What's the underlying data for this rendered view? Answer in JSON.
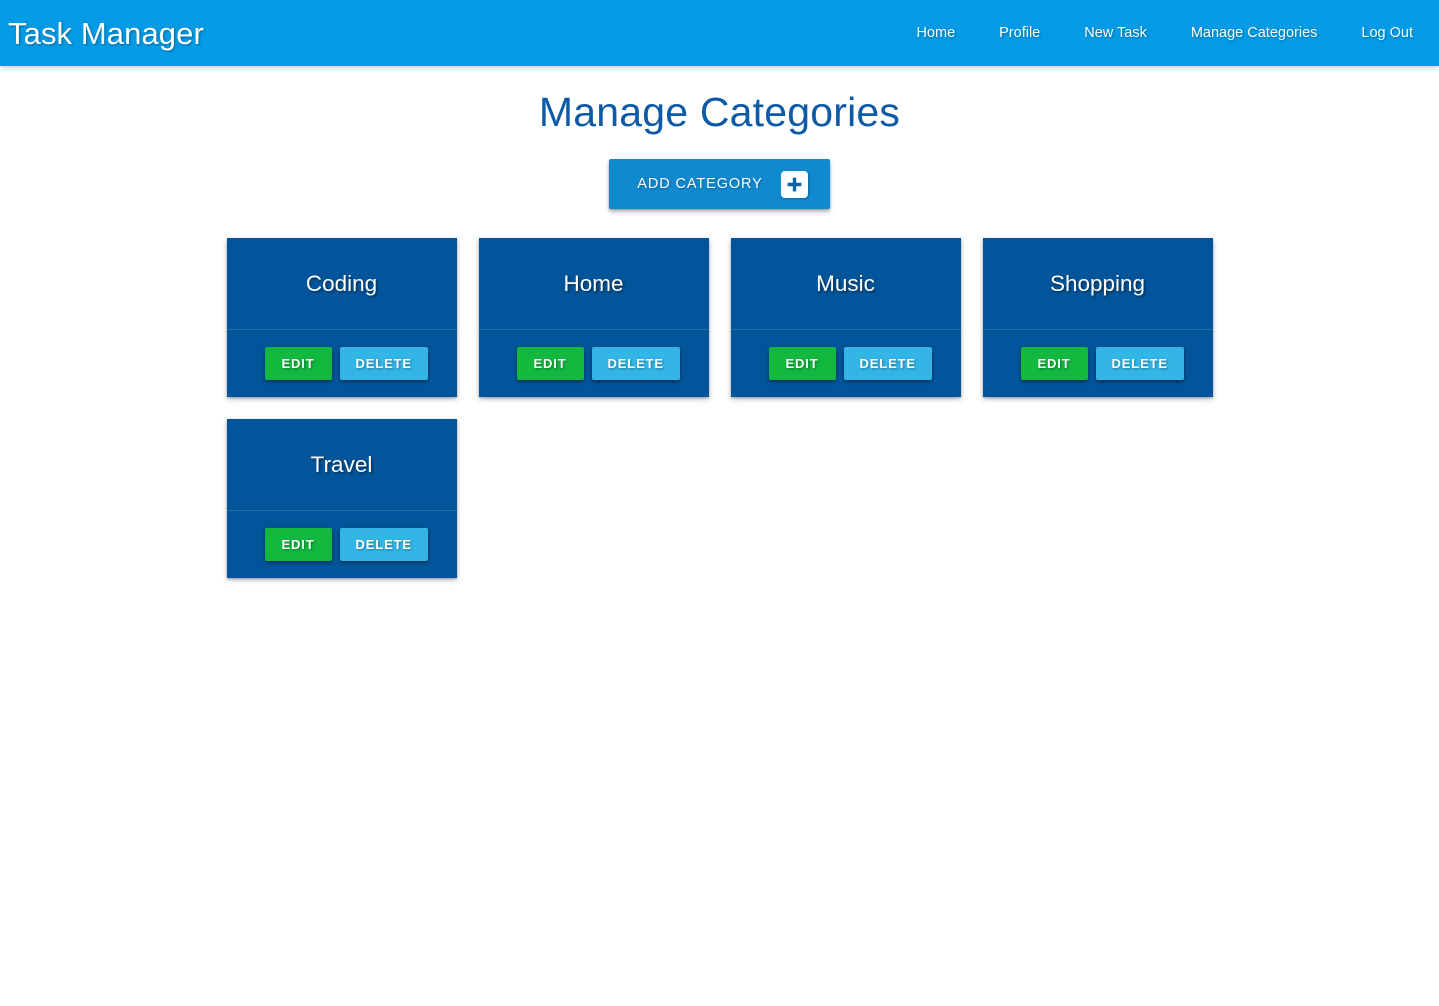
{
  "navbar": {
    "brand": "Task Manager",
    "links": [
      {
        "label": "Home"
      },
      {
        "label": "Profile"
      },
      {
        "label": "New Task"
      },
      {
        "label": "Manage Categories"
      },
      {
        "label": "Log Out"
      }
    ],
    "background_color": "#039be5"
  },
  "main": {
    "page_title": "Manage Categories",
    "page_title_color": "#0d5aa7",
    "add_button": {
      "label": "Add Category",
      "icon": "plus-icon",
      "background_color": "#1189cf"
    }
  },
  "cards": {
    "edit_label": "Edit",
    "delete_label": "Delete",
    "card_background_color": "#02559a",
    "edit_color": "#13b83f",
    "delete_color": "#33b5e5",
    "items": [
      {
        "title": "Coding"
      },
      {
        "title": "Home"
      },
      {
        "title": "Music"
      },
      {
        "title": "Shopping"
      },
      {
        "title": "Travel"
      }
    ]
  }
}
